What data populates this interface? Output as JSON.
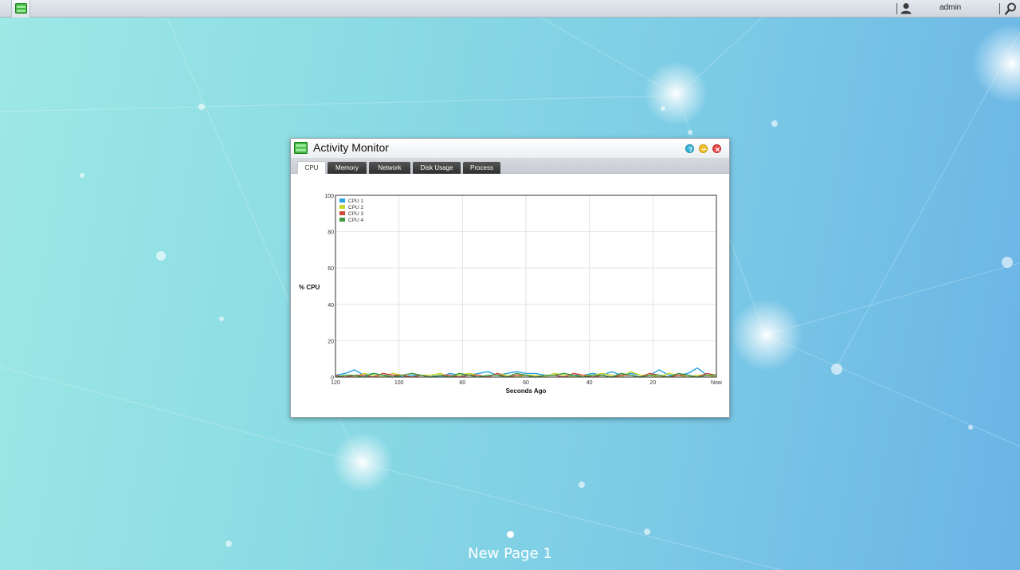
{
  "topbar": {
    "username": "admin"
  },
  "window": {
    "title": "Activity Monitor",
    "tabs": [
      {
        "label": "CPU",
        "active": true
      },
      {
        "label": "Memory",
        "active": false
      },
      {
        "label": "Network",
        "active": false
      },
      {
        "label": "Disk Usage",
        "active": false
      },
      {
        "label": "Process",
        "active": false
      }
    ]
  },
  "desktop": {
    "page_label": "New Page 1"
  },
  "colors": {
    "cpu1": "#29a3e0",
    "cpu2": "#c8d62a",
    "cpu3": "#d1483c",
    "cpu4": "#3f9a3f"
  },
  "icons": {
    "app": "activity-monitor-icon",
    "user": "user-icon",
    "search": "search-icon",
    "help": "help-icon",
    "minimize": "minimize-icon",
    "close": "close-icon"
  },
  "chart_data": {
    "type": "line",
    "ylabel": "% CPU",
    "xlabel": "Seconds Ago",
    "ylim": [
      0,
      100
    ],
    "yticks": [
      0,
      20,
      40,
      60,
      80,
      100
    ],
    "xlim": [
      120,
      0
    ],
    "xticks": [
      {
        "value": 120,
        "label": "120"
      },
      {
        "value": 100,
        "label": "100"
      },
      {
        "value": 80,
        "label": "80"
      },
      {
        "value": 60,
        "label": "60"
      },
      {
        "value": 40,
        "label": "40"
      },
      {
        "value": 20,
        "label": "20"
      },
      {
        "value": 0,
        "label": "Now"
      }
    ],
    "grid": true,
    "legend": "top-left",
    "x": [
      120,
      117,
      114,
      111,
      108,
      105,
      102,
      99,
      96,
      93,
      90,
      87,
      84,
      81,
      78,
      75,
      72,
      69,
      66,
      63,
      60,
      57,
      54,
      51,
      48,
      45,
      42,
      39,
      36,
      33,
      30,
      27,
      24,
      21,
      18,
      15,
      12,
      9,
      6,
      3,
      0
    ],
    "series": [
      {
        "name": "CPU 1",
        "color": "#29a3e0",
        "values": [
          1,
          2,
          4,
          1,
          2,
          1,
          1,
          0,
          1,
          1,
          1,
          0,
          2,
          1,
          1,
          2,
          3,
          1,
          2,
          3,
          2,
          2,
          1,
          1,
          0,
          1,
          1,
          2,
          1,
          3,
          1,
          2,
          1,
          1,
          4,
          1,
          1,
          2,
          5,
          1,
          1
        ]
      },
      {
        "name": "CPU 2",
        "color": "#c8d62a",
        "values": [
          0,
          1,
          0,
          2,
          1,
          0,
          2,
          1,
          0,
          1,
          1,
          2,
          0,
          1,
          2,
          1,
          0,
          2,
          1,
          0,
          1,
          1,
          0,
          2,
          1,
          0,
          1,
          1,
          2,
          1,
          0,
          3,
          1,
          1,
          0,
          2,
          1,
          0,
          1,
          1,
          0
        ]
      },
      {
        "name": "CPU 3",
        "color": "#d1483c",
        "values": [
          1,
          0,
          1,
          1,
          0,
          2,
          1,
          1,
          0,
          1,
          0,
          1,
          1,
          0,
          1,
          1,
          0,
          2,
          0,
          1,
          1,
          0,
          1,
          1,
          0,
          2,
          1,
          0,
          1,
          0,
          1,
          1,
          0,
          2,
          1,
          0,
          1,
          1,
          0,
          2,
          1
        ]
      },
      {
        "name": "CPU 4",
        "color": "#3f9a3f",
        "values": [
          0,
          1,
          1,
          0,
          2,
          1,
          0,
          1,
          2,
          1,
          0,
          1,
          0,
          2,
          1,
          0,
          1,
          1,
          0,
          2,
          1,
          0,
          1,
          1,
          2,
          1,
          0,
          1,
          1,
          0,
          2,
          1,
          0,
          1,
          1,
          0,
          2,
          1,
          0,
          1,
          1
        ]
      }
    ]
  }
}
